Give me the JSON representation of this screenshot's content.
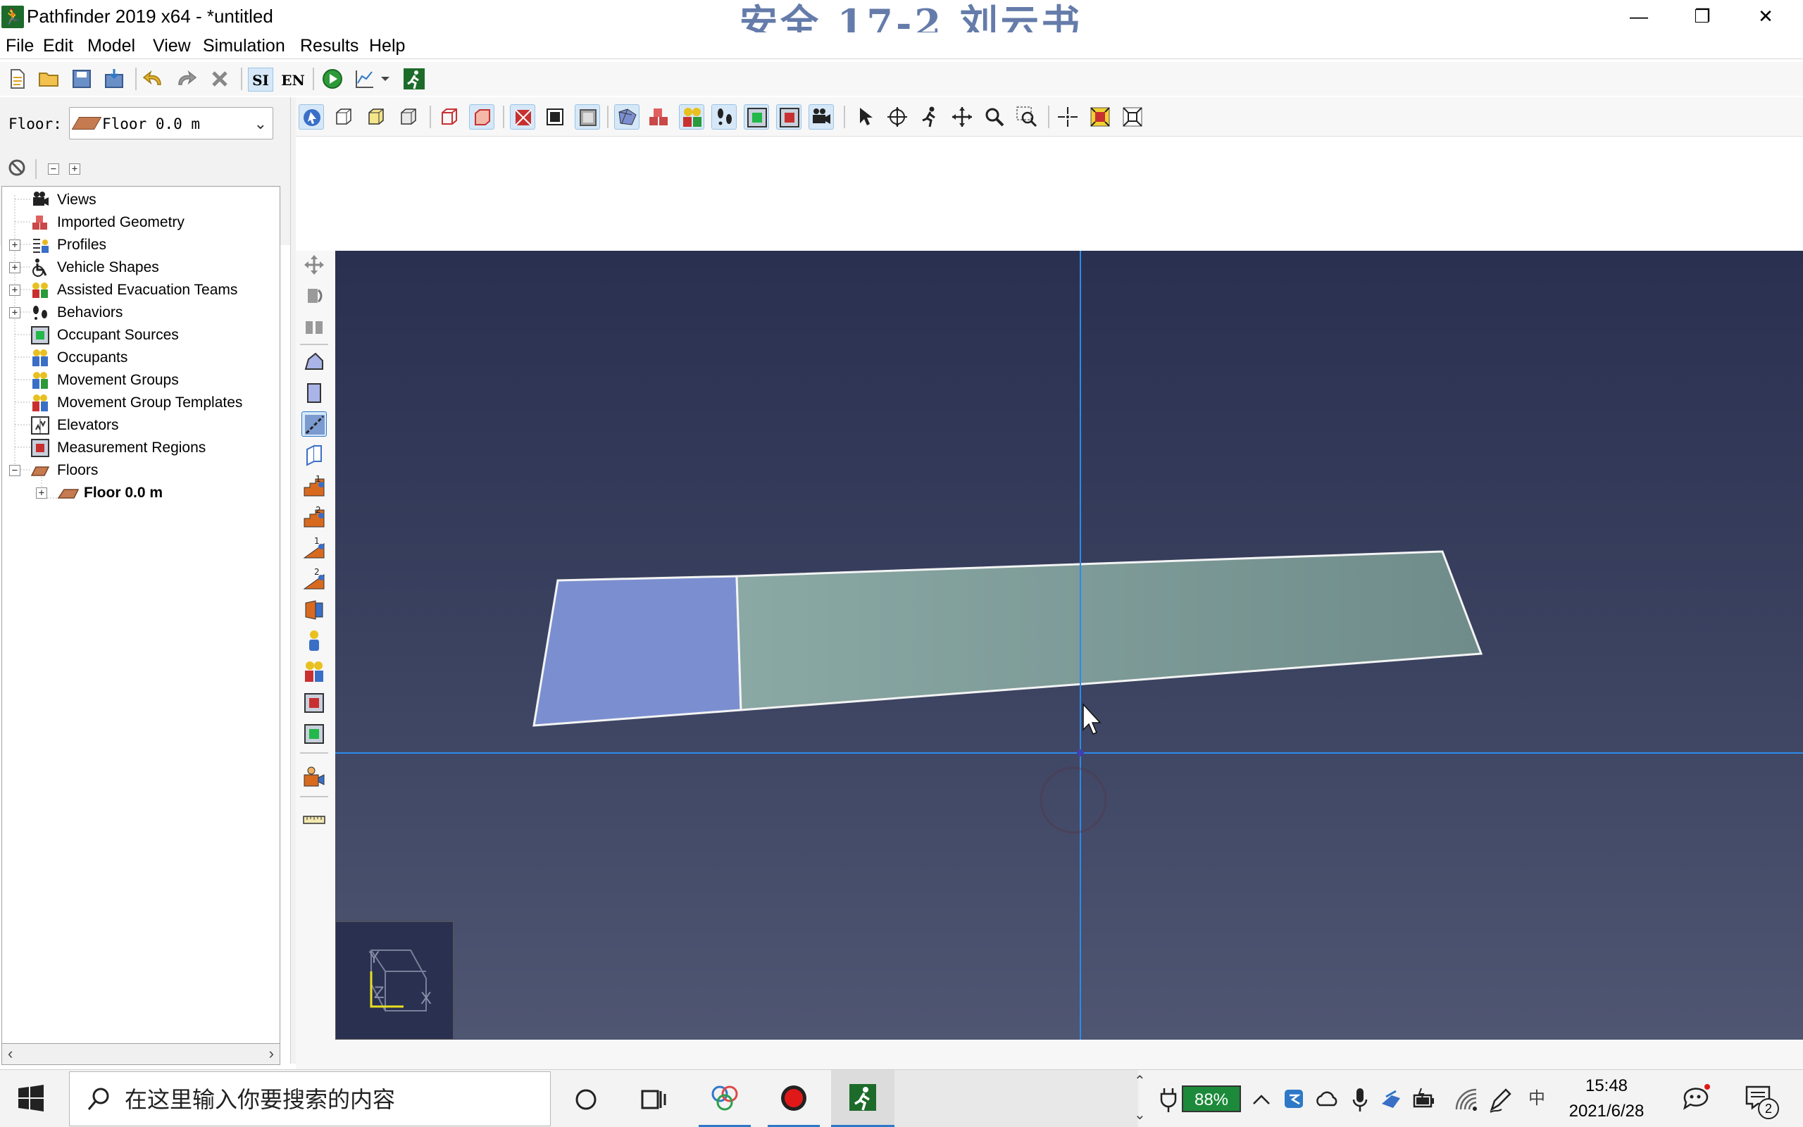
{
  "window": {
    "title": "Pathfinder 2019 x64 - *untitled",
    "watermark": "安全 17-2 刘云书",
    "minimize": "—",
    "restore": "❐",
    "close": "✕"
  },
  "menu": [
    "File",
    "Edit",
    "Model",
    "View",
    "Simulation",
    "Results",
    "Help"
  ],
  "toolbar": {
    "si_label": "SI",
    "en_label": "EN"
  },
  "floor_selector": {
    "label": "Floor:",
    "value": "Floor 0.0 m"
  },
  "tree": {
    "items": [
      {
        "label": "Views",
        "icon": "camera-icon"
      },
      {
        "label": "Imported Geometry",
        "icon": "geometry-icon"
      },
      {
        "label": "Profiles",
        "icon": "profile-icon"
      },
      {
        "label": "Vehicle Shapes",
        "icon": "wheelchair-icon"
      },
      {
        "label": "Assisted Evacuation Teams",
        "icon": "team-icon"
      },
      {
        "label": "Behaviors",
        "icon": "footsteps-icon"
      },
      {
        "label": "Occupant Sources",
        "icon": "source-icon"
      },
      {
        "label": "Occupants",
        "icon": "occupants-icon"
      },
      {
        "label": "Movement Groups",
        "icon": "group-icon"
      },
      {
        "label": "Movement Group Templates",
        "icon": "group-template-icon"
      },
      {
        "label": "Elevators",
        "icon": "elevator-icon"
      },
      {
        "label": "Measurement Regions",
        "icon": "measurement-region-icon"
      },
      {
        "label": "Floors",
        "icon": "floor-icon"
      }
    ],
    "child": {
      "label": "Floor 0.0 m",
      "icon": "floor-icon"
    }
  },
  "axes": {
    "y": "Y",
    "z": "Z",
    "x": "X"
  },
  "taskbar": {
    "search_placeholder": "在这里输入你要搜索的内容",
    "battery": "88%",
    "ime": "中",
    "time": "15:48",
    "date": "2021/6/28",
    "notifications": "2"
  },
  "colors": {
    "accent": "#2e78c8",
    "room_blue": "#7b8fd0",
    "room_teal": "#86a3a0",
    "viewport_top": "#2a3050"
  }
}
